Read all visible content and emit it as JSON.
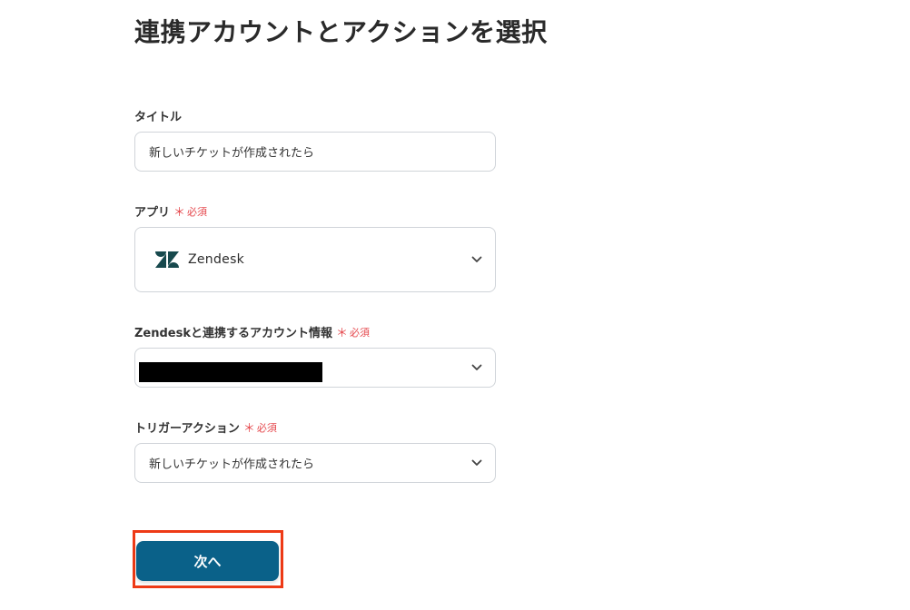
{
  "page": {
    "title": "連携アカウントとアクションを選択"
  },
  "required_mark": "＊",
  "required_text": "必須",
  "colors": {
    "accent": "#0a6189",
    "required": "#e5484d",
    "highlight": "#ee3a16",
    "border": "#d0d4d9"
  },
  "fields": {
    "title": {
      "label": "タイトル",
      "value": "新しいチケットが作成されたら"
    },
    "app": {
      "label": "アプリ",
      "value": "Zendesk",
      "icon": "zendesk-logo"
    },
    "account": {
      "label": "Zendeskと連携するアカウント情報",
      "value_redacted": true
    },
    "trigger": {
      "label": "トリガーアクション",
      "value": "新しいチケットが作成されたら"
    }
  },
  "actions": {
    "next_label": "次へ"
  }
}
